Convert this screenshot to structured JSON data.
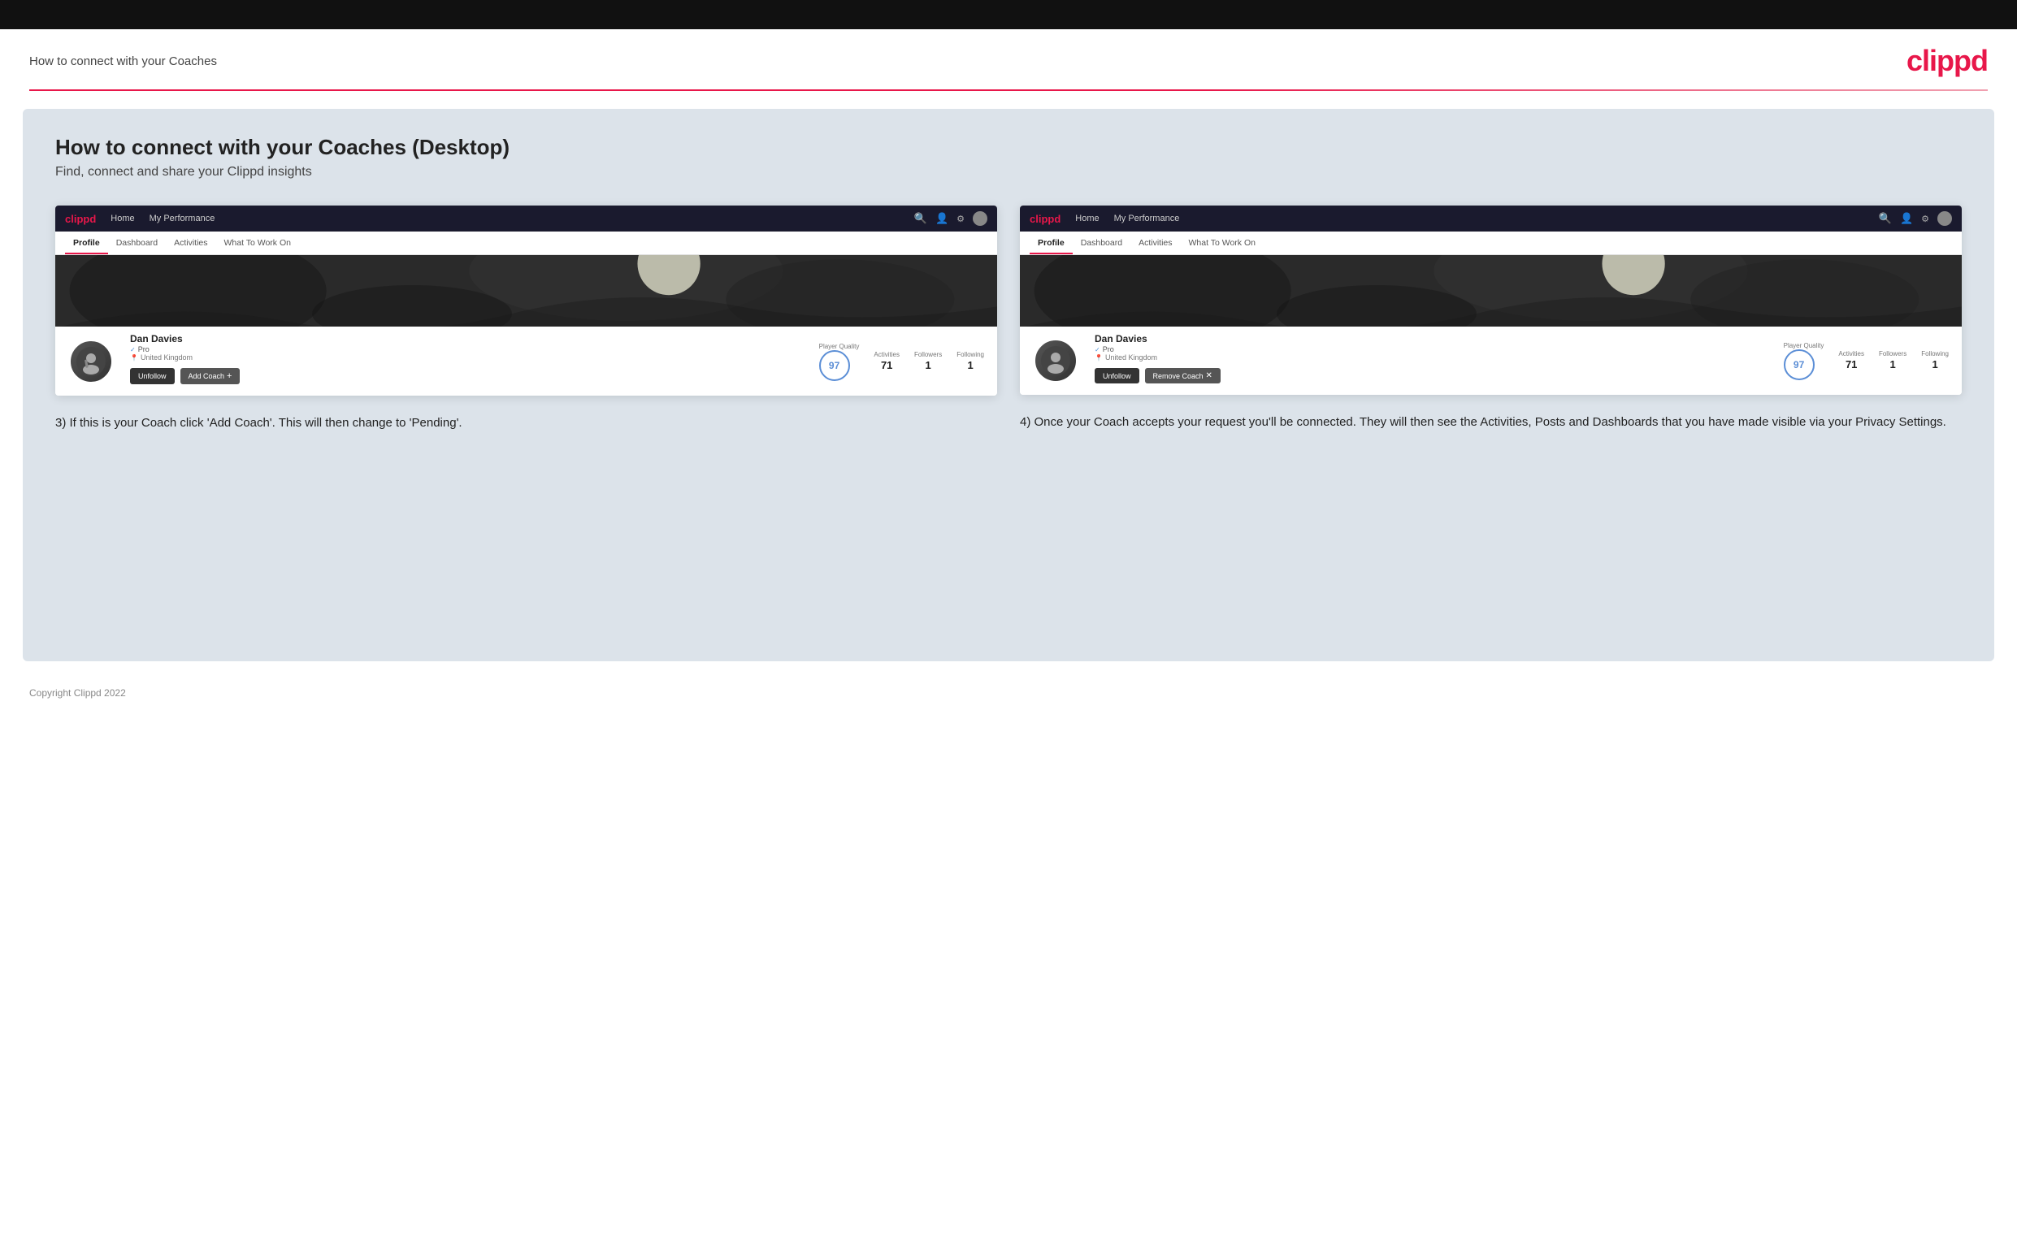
{
  "topbar": {},
  "header": {
    "title": "How to connect with your Coaches",
    "logo": "clippd"
  },
  "main": {
    "heading": "How to connect with your Coaches (Desktop)",
    "subheading": "Find, connect and share your Clippd insights",
    "screenshot_left": {
      "nav": {
        "logo": "clippd",
        "items": [
          "Home",
          "My Performance"
        ]
      },
      "tabs": [
        "Profile",
        "Dashboard",
        "Activities",
        "What To Work On"
      ],
      "active_tab": "Profile",
      "player": {
        "name": "Dan Davies",
        "role": "Pro",
        "location": "United Kingdom",
        "quality": "97",
        "activities": "71",
        "followers": "1",
        "following": "1"
      },
      "labels": {
        "player_quality": "Player Quality",
        "activities": "Activities",
        "followers": "Followers",
        "following": "Following"
      },
      "buttons": {
        "unfollow": "Unfollow",
        "add_coach": "Add Coach"
      }
    },
    "screenshot_right": {
      "nav": {
        "logo": "clippd",
        "items": [
          "Home",
          "My Performance"
        ]
      },
      "tabs": [
        "Profile",
        "Dashboard",
        "Activities",
        "What To Work On"
      ],
      "active_tab": "Profile",
      "player": {
        "name": "Dan Davies",
        "role": "Pro",
        "location": "United Kingdom",
        "quality": "97",
        "activities": "71",
        "followers": "1",
        "following": "1"
      },
      "labels": {
        "player_quality": "Player Quality",
        "activities": "Activities",
        "followers": "Followers",
        "following": "Following"
      },
      "buttons": {
        "unfollow": "Unfollow",
        "remove_coach": "Remove Coach"
      }
    },
    "desc_left": "3) If this is your Coach click 'Add Coach'. This will then change to 'Pending'.",
    "desc_right": "4) Once your Coach accepts your request you'll be connected. They will then see the Activities, Posts and Dashboards that you have made visible via your Privacy Settings."
  },
  "footer": {
    "copyright": "Copyright Clippd 2022"
  }
}
